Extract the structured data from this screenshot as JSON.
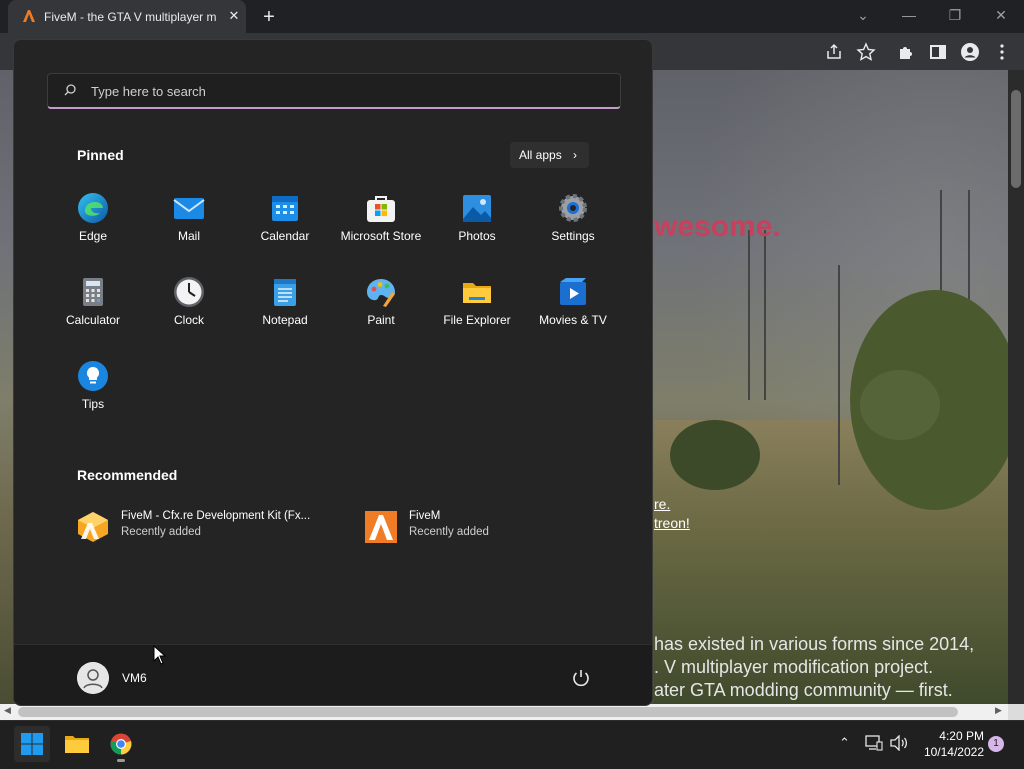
{
  "browser": {
    "tab_title": "FiveM - the GTA V multiplayer m",
    "tab_close": "✕",
    "new_tab": "+",
    "minimize": "—",
    "restore": "❐",
    "close": "✕",
    "chevron": "⌄"
  },
  "page": {
    "headline": "wesome.",
    "link1": "re.",
    "link2": "treon!",
    "para1": "has existed in various forms since 2014,",
    "para2": ". V multiplayer modification project.",
    "para3": "ater GTA modding community — first.",
    "accent": "#c7405d"
  },
  "start_menu": {
    "search_placeholder": "Type here to search",
    "pinned_title": "Pinned",
    "all_apps_label": "All apps",
    "pinned_apps": [
      {
        "label": "Edge",
        "icon": "edge-icon"
      },
      {
        "label": "Mail",
        "icon": "mail-icon"
      },
      {
        "label": "Calendar",
        "icon": "calendar-icon"
      },
      {
        "label": "Microsoft Store",
        "icon": "store-icon"
      },
      {
        "label": "Photos",
        "icon": "photos-icon"
      },
      {
        "label": "Settings",
        "icon": "settings-icon"
      },
      {
        "label": "Calculator",
        "icon": "calculator-icon"
      },
      {
        "label": "Clock",
        "icon": "clock-icon"
      },
      {
        "label": "Notepad",
        "icon": "notepad-icon"
      },
      {
        "label": "Paint",
        "icon": "paint-icon"
      },
      {
        "label": "File Explorer",
        "icon": "folder-icon"
      },
      {
        "label": "Movies & TV",
        "icon": "movies-icon"
      },
      {
        "label": "Tips",
        "icon": "tips-icon"
      }
    ],
    "recommended_title": "Recommended",
    "recommended": [
      {
        "name": "FiveM - Cfx.re Development Kit (Fx...",
        "sub": "Recently added",
        "icon": "fxdk-icon"
      },
      {
        "name": "FiveM",
        "sub": "Recently added",
        "icon": "fivem-icon"
      }
    ],
    "user_name": "VM6"
  },
  "taskbar": {
    "time": "4:20 PM",
    "date": "10/14/2022",
    "notification_count": "1",
    "tray_chevron": "⌃"
  }
}
